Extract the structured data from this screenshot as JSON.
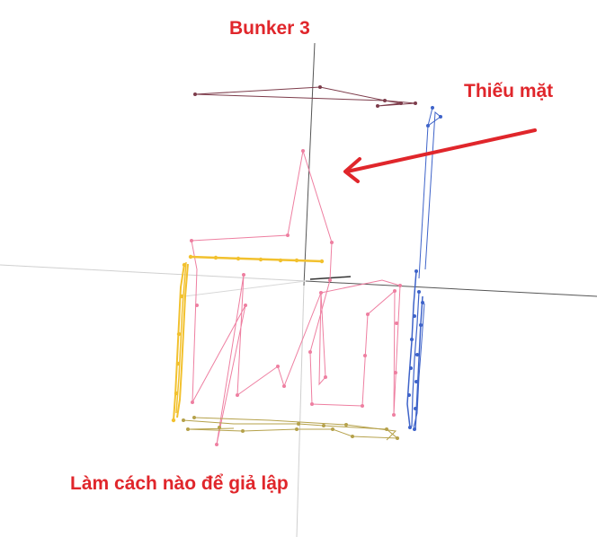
{
  "annotations": {
    "title": "Bunker 3",
    "missing_note": "Thiếu mặt",
    "question": "Làm cách nào để giả lập"
  },
  "colors": {
    "annotation": "#e0262b",
    "axis_main": "#555555",
    "axis_faint": "#c8c8c8",
    "arrow": "#e0262b",
    "top_outline": "#7d3c4b",
    "pink_outline": "#ee7fa1",
    "yellow_outline": "#f2c12e",
    "olive_outline": "#b5a14a",
    "blue_outline": "#3e63c9"
  },
  "icons": {
    "pointer": "arrow-left-icon"
  }
}
